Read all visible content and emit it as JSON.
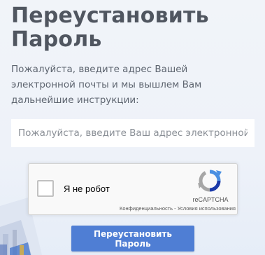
{
  "page": {
    "title_line1": "Переустановить",
    "title_line2": "Пароль",
    "description": "Пожалуйста, введите адрес Вашей электронной почты и мы вышлем Вам дальнейшие инструкции:"
  },
  "form": {
    "email_placeholder": "Пожалуйста, введите Ваш адрес электронной почты",
    "submit_label": "Переустановить Пароль"
  },
  "recaptcha": {
    "checkbox_label": "Я не робот",
    "brand": "reCAPTCHA",
    "privacy_link": "Конфиденциальность",
    "separator": " - ",
    "terms_link": "Условия использования",
    "logo_icon": "recaptcha-logo-icon"
  },
  "colors": {
    "accent": "#4f7ed4",
    "heading": "#505660",
    "text": "#5e6570"
  }
}
